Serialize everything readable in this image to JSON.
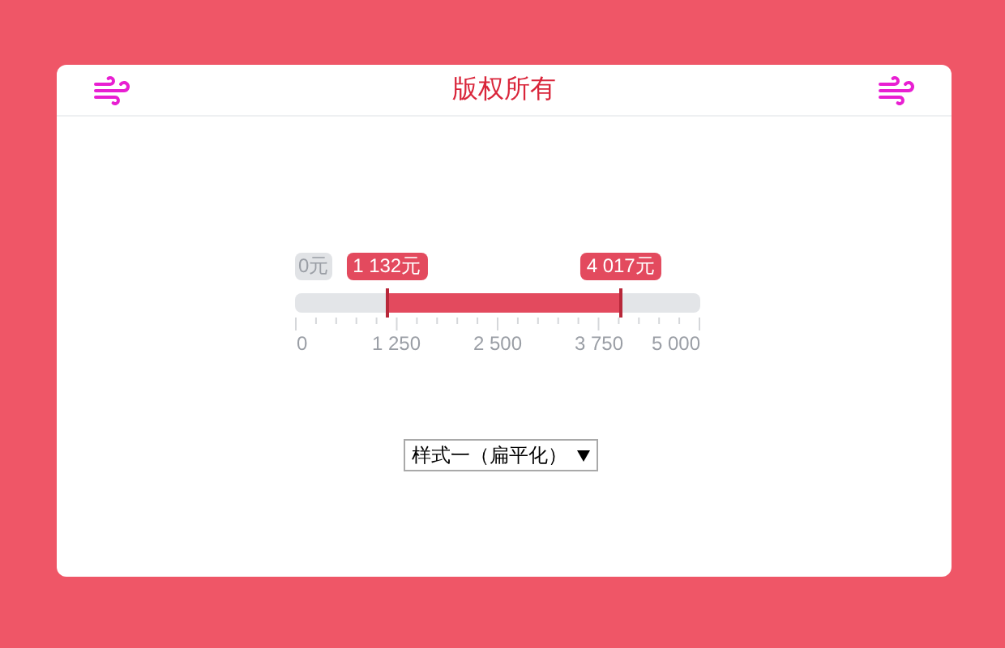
{
  "header": {
    "title": "版权所有"
  },
  "slider": {
    "min_label": "0元",
    "handles": [
      {
        "label": "1 132元",
        "level": 0.2264
      },
      {
        "label": "4 017元",
        "level": 0.8034
      }
    ],
    "ticks": [
      "0",
      "1 250",
      "2 500",
      "3 750",
      "5 000"
    ]
  },
  "style_select": {
    "value": "样式一（扁平化）"
  }
}
